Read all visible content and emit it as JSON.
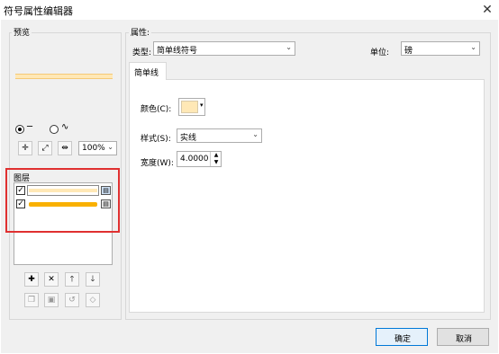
{
  "window": {
    "title": "符号属性编辑器",
    "close_glyph": "✕"
  },
  "preview": {
    "group_label": "预览",
    "swatch_colors": [
      "#ffe8b6",
      "#f9b000"
    ],
    "radio_line_label": "─",
    "radio_wave_label": "∿",
    "zoom_value": "100%",
    "tool_icons": [
      "zoom-in-icon",
      "zoom-fit-icon",
      "actual-size-icon"
    ]
  },
  "layers": {
    "group_label": "图层",
    "items": [
      {
        "checked": true,
        "color": "#ffe8b6"
      },
      {
        "checked": true,
        "color": "#f9b000"
      }
    ],
    "highlight_color": "#e03030",
    "buttons": [
      "add-icon",
      "delete-icon",
      "move-up-icon",
      "move-down-icon"
    ],
    "tool_buttons": [
      "copy-icon",
      "paste-icon",
      "reset-icon",
      "mark-icon"
    ]
  },
  "properties": {
    "group_label": "属性:",
    "type_label": "类型:",
    "type_value": "简单线符号",
    "unit_label": "单位:",
    "unit_value": "磅",
    "tab_label": "简单线",
    "color_label": "颜色(C):",
    "color_value": "#ffe8b6",
    "style_label": "样式(S):",
    "style_value": "实线",
    "width_label": "宽度(W):",
    "width_value": "4.0000"
  },
  "footer": {
    "ok_label": "确定",
    "cancel_label": "取消"
  }
}
